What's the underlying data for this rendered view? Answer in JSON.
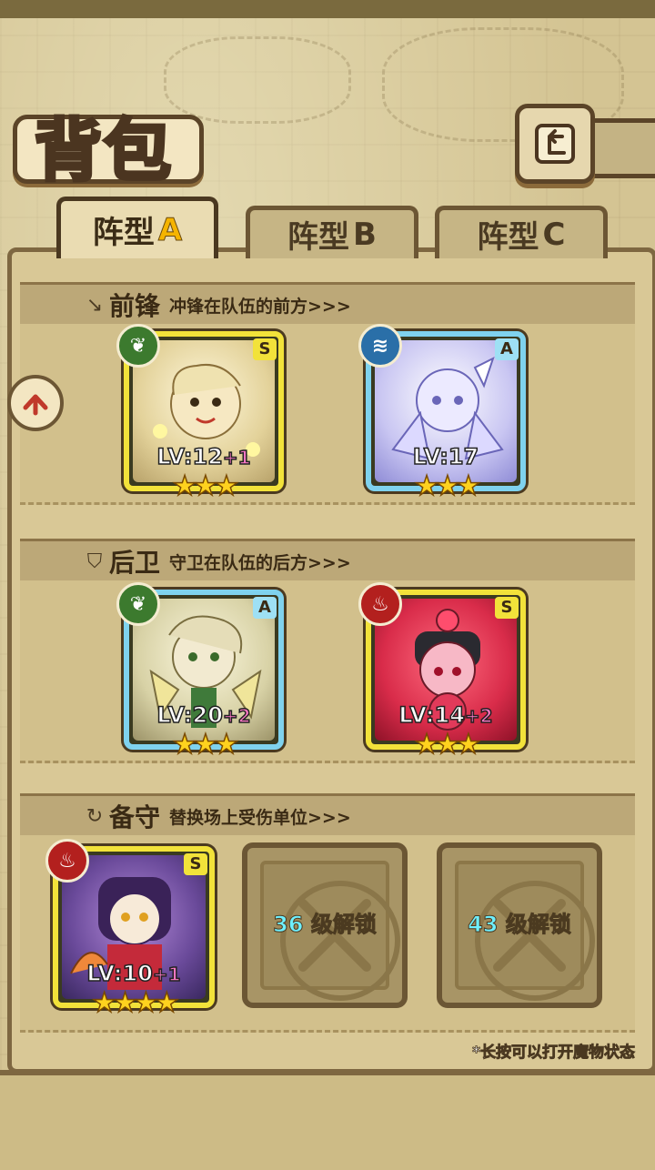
{
  "header": {
    "title": "背包"
  },
  "tabs": [
    {
      "label": "阵型",
      "suffix": "A",
      "active": true
    },
    {
      "label": "阵型",
      "suffix": "B",
      "active": false
    },
    {
      "label": "阵型",
      "suffix": "C",
      "active": false
    }
  ],
  "sections": {
    "front": {
      "title": "前锋",
      "desc": "冲锋在队伍的前方>>>"
    },
    "back": {
      "title": "后卫",
      "desc": "守卫在队伍的后方>>>"
    },
    "reserve": {
      "title": "备守",
      "desc": "替换场上受伤单位>>>"
    }
  },
  "cards": [
    {
      "rank": "S",
      "element": "wood",
      "lv": "LV:12",
      "plus": "+1",
      "stars": "★★★"
    },
    {
      "rank": "A",
      "element": "water",
      "lv": "LV:17",
      "plus": "",
      "stars": "★★★"
    },
    {
      "rank": "A",
      "element": "wood",
      "lv": "LV:20",
      "plus": "+2",
      "stars": "★★★"
    },
    {
      "rank": "S",
      "element": "fire",
      "lv": "LV:14",
      "plus": "+2",
      "stars": "★★★"
    },
    {
      "rank": "S",
      "element": "fire",
      "lv": "LV:10",
      "plus": "+1",
      "stars": "★★★★"
    }
  ],
  "locked_slots": [
    {
      "level": "36",
      "text": "级解锁"
    },
    {
      "level": "43",
      "text": "级解锁"
    }
  ],
  "hint": "*长按可以打开魔物状态",
  "colors": {
    "s_frame": "#f2e23a",
    "a_frame": "#7fd2ee",
    "wood": "#3c7a2e",
    "water": "#2a6fa8",
    "fire": "#b3201e"
  }
}
